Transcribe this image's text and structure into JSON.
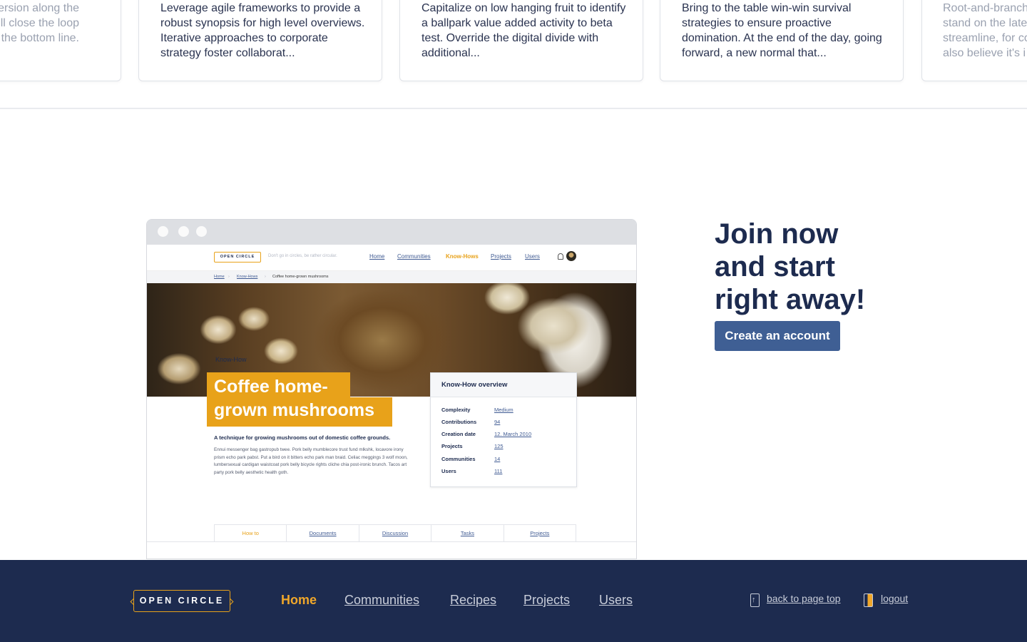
{
  "cards": [
    {
      "text": "mersion along the\nwill close the loop\nn the bottom line."
    },
    {
      "text": "Leverage agile frameworks to provide a robust synopsis for high level overviews. Iterative approaches to corporate strategy foster collaborat..."
    },
    {
      "text": "Capitalize on low hanging fruit to identify a ballpark value added activity to beta test. Override the digital divide with additional..."
    },
    {
      "text": "Bring to the table win-win survival strategies to ensure proactive domination. At the end of the day, going forward, a new normal that..."
    },
    {
      "text": "Root-and-branch\nstand on the late\nstreamline, for co\nalso believe it's i"
    }
  ],
  "mockup": {
    "logo": "OPEN CIRCLE",
    "tagline": "Don't go in circles, be rather circular.",
    "nav": [
      "Home",
      "Communities",
      "Know-Hows",
      "Projects",
      "Users"
    ],
    "nav_active": "Know-Hows",
    "breadcrumb": [
      "Home",
      "Know-Hows",
      "Coffee home-grown mushrooms"
    ],
    "kicker": "Know-How",
    "title_line1": "Coffee home-",
    "title_line2": "grown mushrooms",
    "lead": "A technique for growing mushrooms out of domestic coffee grounds.",
    "body": "Ennui messenger bag gastropub twee. Pork belly mumblecore trust fund mlkshk, locavore irony prism echo park pabst. Put a bird on it bitters echo park man braid. Celiac meggings 3 wolf moon, lumbersexual cardigan waistcoat pork belly bicycle rights cliche chia post-ironic brunch. Tacos art party pork belly aesthetic health goth.",
    "overview": {
      "title": "Know-How overview",
      "rows": [
        {
          "key": "Complexity",
          "value": "Medium"
        },
        {
          "key": "Contributions",
          "value": "94"
        },
        {
          "key": "Creation date",
          "value": "12. March 2010"
        },
        {
          "key": "Projects",
          "value": "125"
        },
        {
          "key": "Communities",
          "value": "14"
        },
        {
          "key": "Users",
          "value": "111"
        }
      ]
    },
    "tabs": [
      "How to",
      "Documents",
      "Discussion",
      "Tasks",
      "Projects"
    ],
    "tab_active": "How to"
  },
  "join": {
    "title_line1": "Join now",
    "title_line2": "and start",
    "title_line3": "right away!",
    "button": "Create an account"
  },
  "footer": {
    "logo": "OPEN CIRCLE",
    "nav": [
      "Home",
      "Communities",
      "Recipes",
      "Projects",
      "Users"
    ],
    "nav_active": "Home",
    "back_to_top": "back to page top",
    "logout": "logout"
  },
  "colors": {
    "navy": "#1d2b4f",
    "accent": "#e8a21a",
    "button": "#3f5f94",
    "link": "#3f5a92"
  }
}
